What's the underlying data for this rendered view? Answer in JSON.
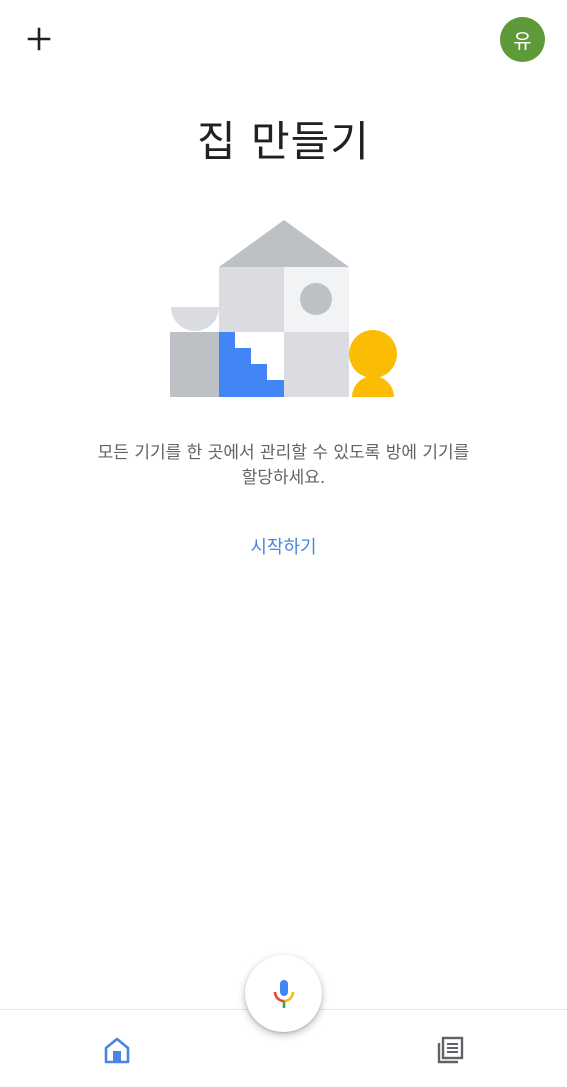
{
  "header": {
    "add_icon": "plus-icon",
    "avatar_initial": "유",
    "avatar_color": "#5f9a3a"
  },
  "main": {
    "title": "집 만들기",
    "description_line1": "모든 기기를 한 곳에서 관리할 수 있도록 방에 기기를",
    "description_line2": "할당하세요.",
    "start_link": "시작하기",
    "link_color": "#4a86e0"
  },
  "nav": {
    "home_icon": "home-icon",
    "feed_icon": "feed-icon",
    "mic_icon": "microphone-icon",
    "active_color": "#4a86e0"
  }
}
